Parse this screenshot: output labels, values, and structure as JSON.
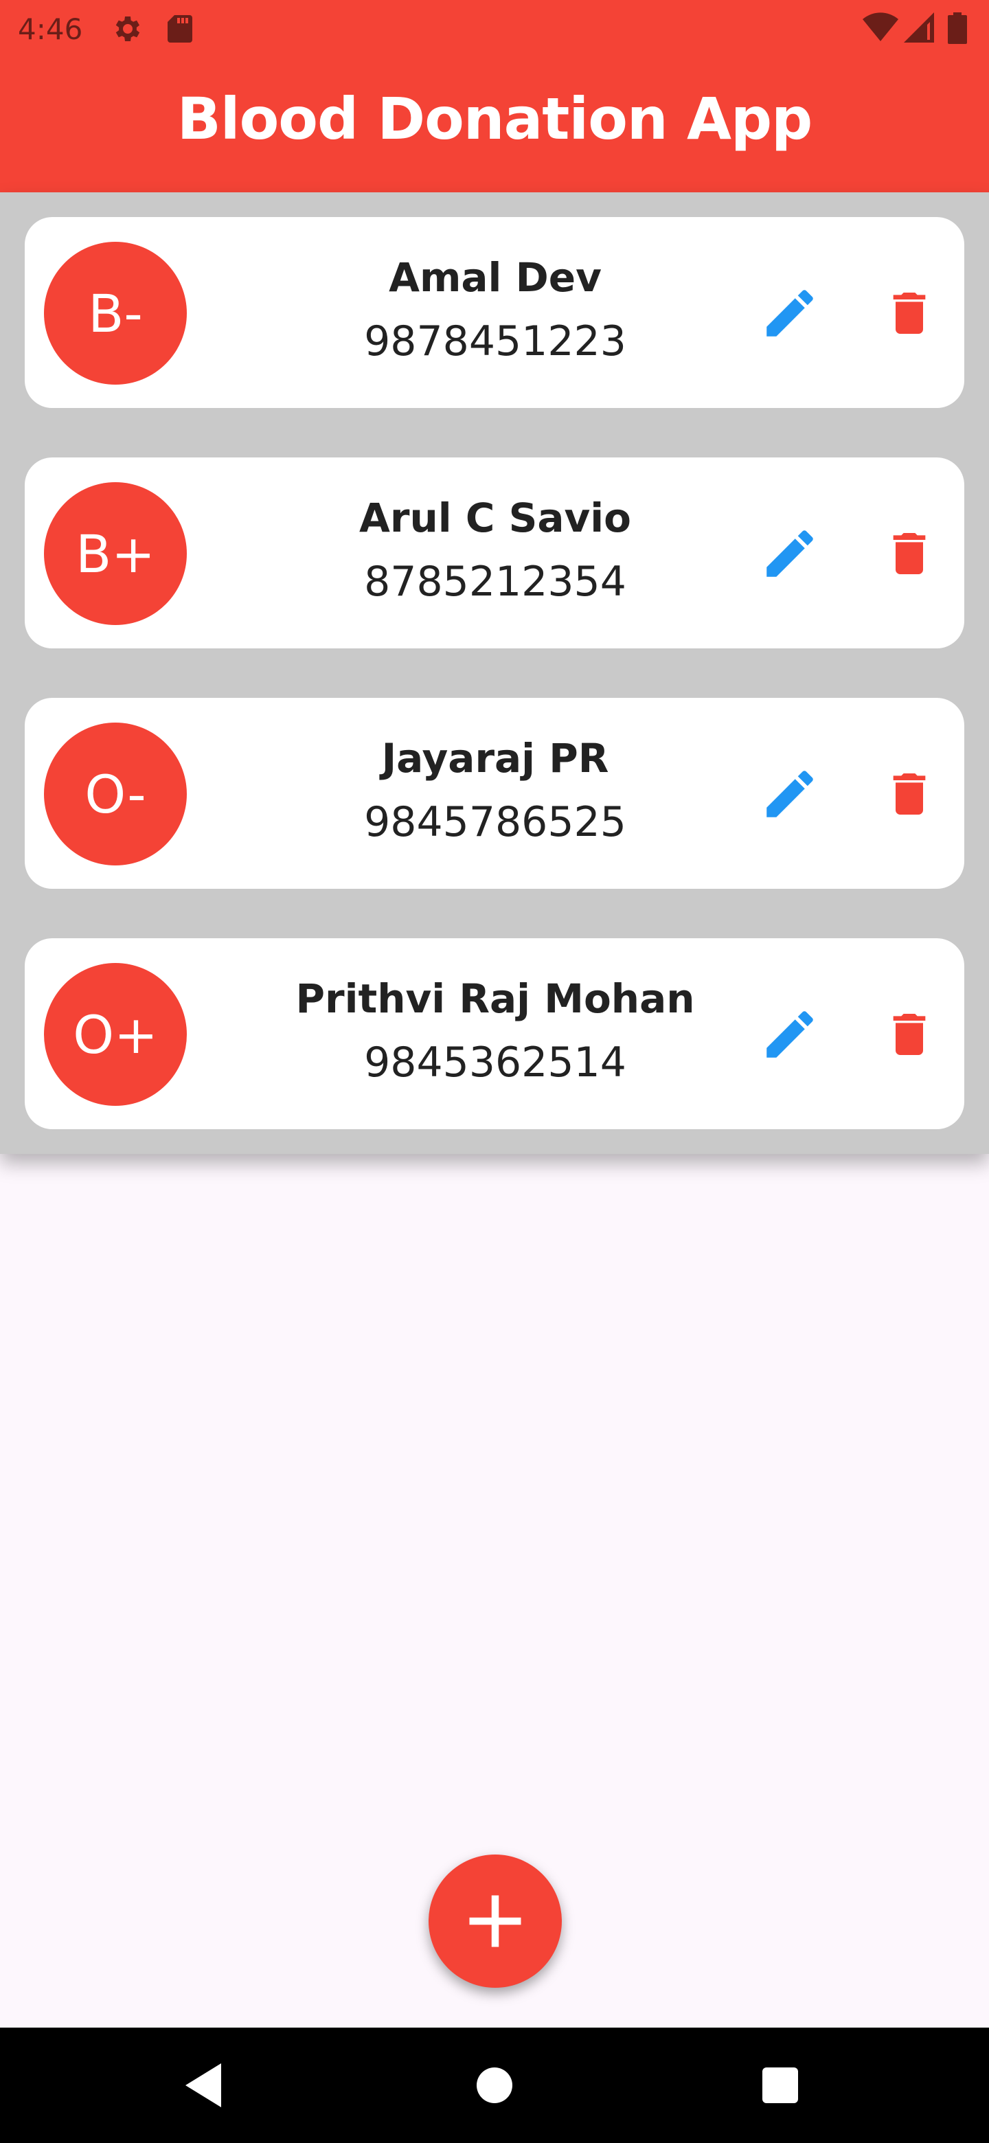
{
  "status_bar": {
    "time": "4:46",
    "icons": [
      "settings-icon",
      "sd-card-icon",
      "wifi-icon",
      "signal-icon",
      "battery-icon"
    ]
  },
  "app_bar": {
    "title": "Blood Donation App"
  },
  "donors": [
    {
      "blood_group": "B-",
      "name": "Amal Dev",
      "phone": "9878451223"
    },
    {
      "blood_group": "B+",
      "name": "Arul C Savio",
      "phone": "8785212354"
    },
    {
      "blood_group": "O-",
      "name": "Jayaraj PR",
      "phone": "9845786525"
    },
    {
      "blood_group": "O+",
      "name": "Prithvi Raj Mohan",
      "phone": "9845362514"
    }
  ],
  "actions": {
    "edit_icon": "pencil-icon",
    "delete_icon": "trash-icon",
    "add_icon": "plus-icon"
  },
  "colors": {
    "primary": "#F44336",
    "edit": "#2196F3",
    "background": "#FDF7FD",
    "list_background": "#C9C9C9"
  },
  "nav": {
    "icons": [
      "back-icon",
      "home-icon",
      "recents-icon"
    ]
  }
}
